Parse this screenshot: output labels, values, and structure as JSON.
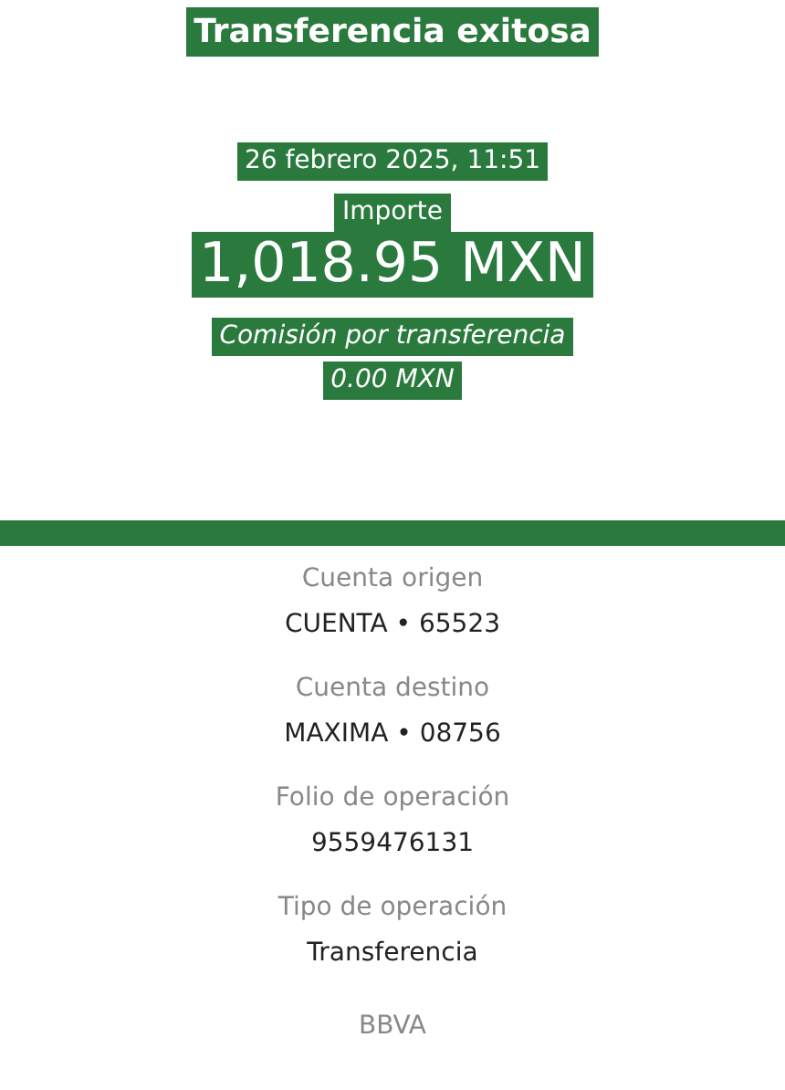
{
  "header": {
    "title": "Transferencia exitosa",
    "date": "26 febrero 2025, 11:51",
    "amount_label": "Importe",
    "amount": "1,018.95 MXN",
    "fee_label": "Comisión por transferencia",
    "fee": "0.00 MXN"
  },
  "details": [
    {
      "label": "Cuenta origen",
      "value": "CUENTA • 65523"
    },
    {
      "label": "Cuenta destino",
      "value": "MAXIMA • 08756"
    },
    {
      "label": "Folio de operación",
      "value": "9559476131"
    },
    {
      "label": "Tipo de operación",
      "value": "Transferencia"
    }
  ],
  "footer": "BBVA"
}
